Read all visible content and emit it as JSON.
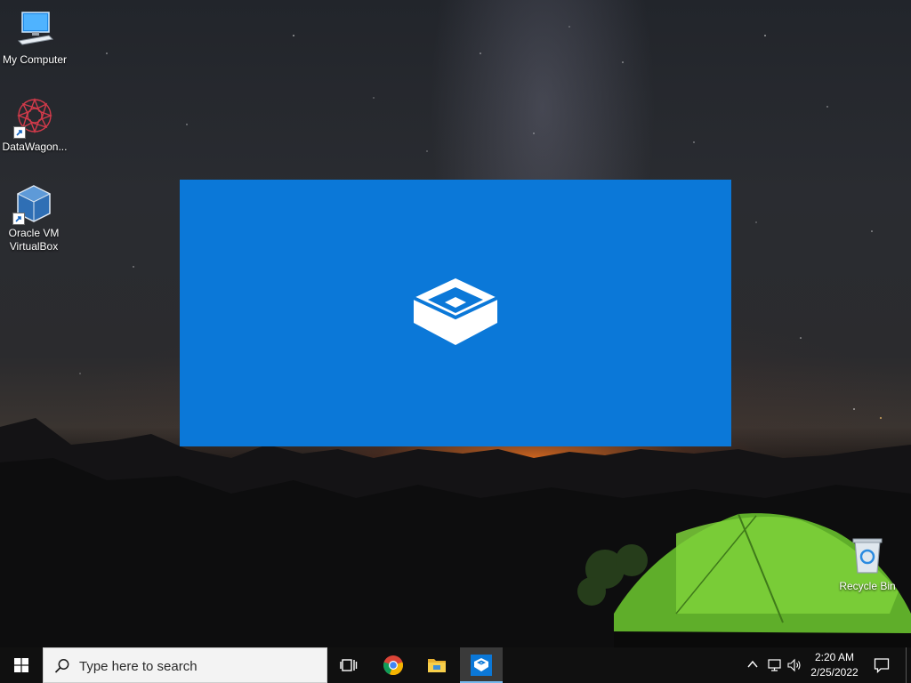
{
  "desktop": {
    "icons": [
      {
        "label": "My Computer",
        "icon": "computer-icon"
      },
      {
        "label": "DataWagon...",
        "icon": "datawagon-icon"
      },
      {
        "label": "Oracle VM VirtualBox",
        "icon": "virtualbox-icon"
      },
      {
        "label": "Recycle Bin",
        "icon": "recycle-bin-icon"
      }
    ]
  },
  "splash": {
    "icon": "sandbox-box-icon",
    "background": "#0b78d8"
  },
  "taskbar": {
    "search_placeholder": "Type here to search",
    "pinned": [
      {
        "name": "Task View",
        "icon": "task-view-icon"
      },
      {
        "name": "Google Chrome",
        "icon": "chrome-icon"
      },
      {
        "name": "File Explorer",
        "icon": "folder-icon"
      },
      {
        "name": "Windows Sandbox",
        "icon": "sandbox-icon",
        "active": true
      }
    ],
    "tray": {
      "time": "2:20 AM",
      "date": "2/25/2022"
    },
    "accent": "#76b9ed"
  }
}
